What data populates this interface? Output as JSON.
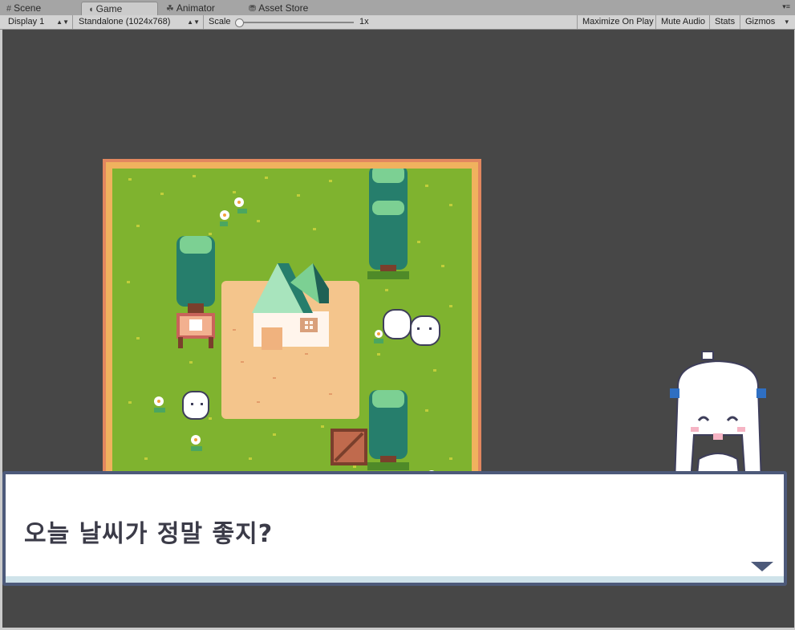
{
  "tabs": [
    {
      "label": "Scene",
      "icon": "#"
    },
    {
      "label": "Game",
      "icon": "◖"
    },
    {
      "label": "Animator",
      "icon": "☘"
    },
    {
      "label": "Asset Store",
      "icon": "⛃"
    }
  ],
  "toolbar": {
    "display": "Display 1",
    "resolution": "Standalone (1024x768)",
    "scale_label": "Scale",
    "scale_value": "1x",
    "maximize": "Maximize On Play",
    "mute": "Mute Audio",
    "stats": "Stats",
    "gizmos": "Gizmos"
  },
  "dialog": {
    "text": "오늘 날씨가 정말 좋지?"
  },
  "colors": {
    "editor_bg": "#474747",
    "grass": "#7fb32f",
    "dirt": "#f4c58c",
    "tree_dark": "#267e6c",
    "tree_light": "#7cd093",
    "dialog_border": "#4d5a7a"
  }
}
